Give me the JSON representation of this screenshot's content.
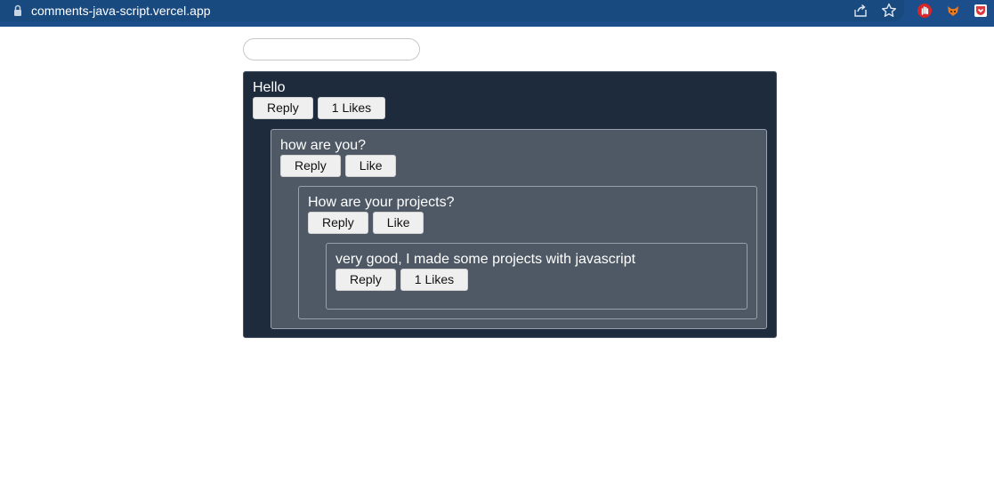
{
  "browser": {
    "url": "comments-java-script.vercel.app",
    "icons": [
      "lock-icon",
      "share-icon",
      "star-icon",
      "hand-extension-icon",
      "fox-extension-icon",
      "pocket-extension-icon"
    ],
    "colors": {
      "chrome_bg": "#1b4e8a",
      "url_bg": "#184a80"
    }
  },
  "search": {
    "value": "",
    "placeholder": ""
  },
  "colors": {
    "root_comment_bg": "#1e2b3c",
    "nested_comment_bg": "#4e5965",
    "button_bg": "#efefef"
  },
  "comments": [
    {
      "text": "Hello",
      "reply_label": "Reply",
      "like_label": "1 Likes"
    },
    {
      "text": "how are you?",
      "reply_label": "Reply",
      "like_label": "Like"
    },
    {
      "text": "How are your projects?",
      "reply_label": "Reply",
      "like_label": "Like"
    },
    {
      "text": "very good, I made some projects with javascript",
      "reply_label": "Reply",
      "like_label": "1 Likes"
    }
  ]
}
